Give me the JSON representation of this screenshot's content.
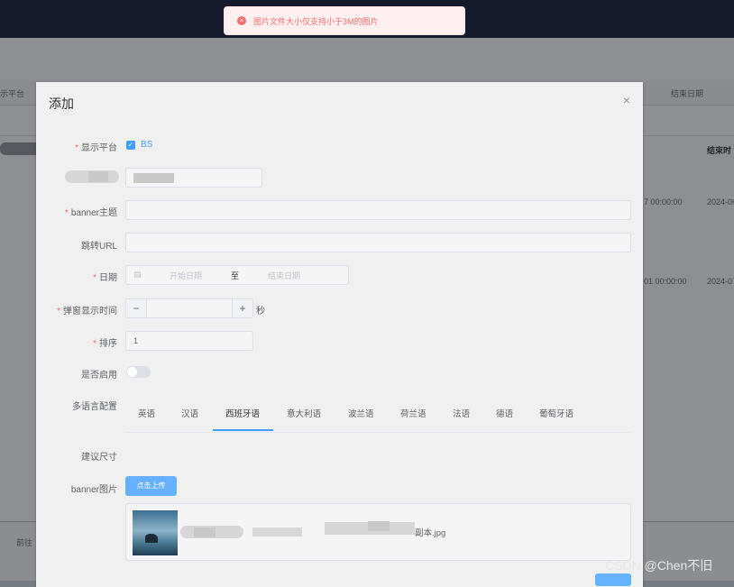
{
  "toast": {
    "message": "图片文件大小仅支持小于3M的图片",
    "icon": "error-circle-icon"
  },
  "background": {
    "col_platform": "示平台",
    "col_end": "结束日期",
    "col_end2": "结束时",
    "row1_time": "7 00:00:00",
    "row1_date": "2024-06",
    "row2_time": "01 00:00:00",
    "row2_date": "2024-07",
    "pager_text": "前往"
  },
  "dialog": {
    "title": "添加",
    "close_icon": "close-icon",
    "fields": {
      "platform": {
        "label": "显示平台",
        "option": "BS",
        "checked": true
      },
      "banner_title": {
        "label": "banner主题",
        "value": ""
      },
      "jump_url": {
        "label": "跳转URL",
        "value": ""
      },
      "date": {
        "label": "日期",
        "start_placeholder": "开始日期",
        "separator": "至",
        "end_placeholder": "结束日期"
      },
      "popup_time": {
        "label": "弹窗显示时间",
        "minus": "−",
        "plus": "+",
        "unit": "秒",
        "value": ""
      },
      "sort": {
        "label": "排序",
        "value": "1"
      },
      "enabled": {
        "label": "是否启用",
        "on": false
      },
      "multilang": {
        "label": "多语言配置"
      },
      "suggest_size": {
        "label": "建议尺寸"
      },
      "banner_image": {
        "label": "banner图片",
        "upload_button": "点击上传",
        "file_name": "副本.jpg"
      }
    },
    "tabs": [
      {
        "label": "英语"
      },
      {
        "label": "汉语"
      },
      {
        "label": "西班牙语"
      },
      {
        "label": "意大利语"
      },
      {
        "label": "波兰语"
      },
      {
        "label": "荷兰语"
      },
      {
        "label": "法语"
      },
      {
        "label": "德语"
      },
      {
        "label": "葡萄牙语"
      }
    ],
    "active_tab": "西班牙语"
  },
  "watermark": "CSDN @Chen不旧",
  "colors": {
    "accent": "#409eff",
    "error": "#f56c6c",
    "topbar": "#141a2b"
  }
}
